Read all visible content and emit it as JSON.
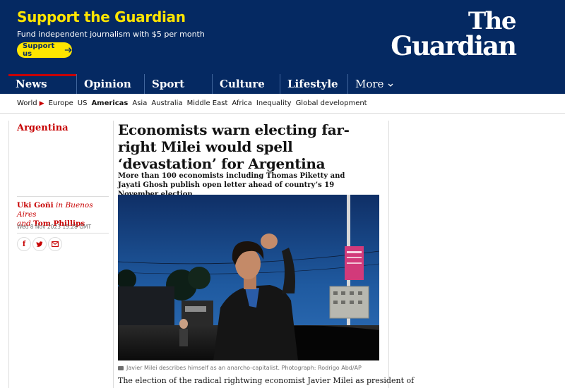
{
  "support": {
    "title": "Support the Guardian",
    "subtitle": "Fund independent journalism with $5 per month",
    "button_label": "Support us"
  },
  "logo": {
    "line1": "The",
    "line2": "Guardian"
  },
  "pillars": [
    {
      "label": "News",
      "active": true
    },
    {
      "label": "Opinion"
    },
    {
      "label": "Sport"
    },
    {
      "label": "Culture"
    },
    {
      "label": "Lifestyle"
    },
    {
      "label": "More"
    }
  ],
  "subnav": {
    "world": "World",
    "items": [
      "Europe",
      "US",
      "Americas",
      "Asia",
      "Australia",
      "Middle East",
      "Africa",
      "Inequality",
      "Global development"
    ]
  },
  "article": {
    "section": "Argentina",
    "headline": "Economists warn electing far-right Milei would spell ‘devastation’ for Argentina",
    "standfirst": "More than 100 economists including Thomas Piketty and Jayati Ghosh publish open letter ahead of country’s 19 November election",
    "byline": {
      "author1": "Uki Goñi",
      "in_text": " in Buenos Aires",
      "and_text": "and",
      "author2": "Tom Phillips"
    },
    "date": "Wed 8 Nov 2023 19.28 GMT",
    "caption": "Javier Milei describes himself as an anarcho-capitalist. Photograph: Rodrigo Abd/AP",
    "body_start": "The election of the radical rightwing economist Javier Milei as president of"
  },
  "share": {
    "facebook": "f",
    "twitter": "twitter-icon",
    "email": "email-icon"
  },
  "colors": {
    "brand": "#052962",
    "accent_yellow": "#ffe500",
    "news_red": "#c70000"
  }
}
